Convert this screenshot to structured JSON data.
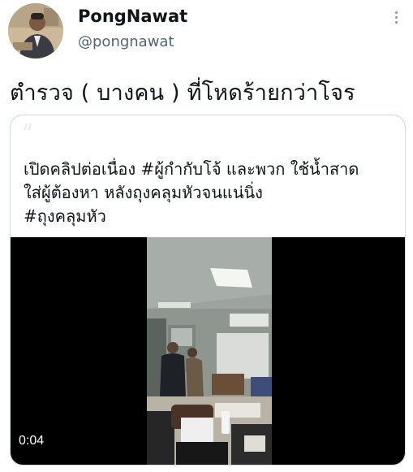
{
  "tweet": {
    "display_name": "PongNawat",
    "handle": "@pongnawat",
    "text": "ตำรวจ ( บางคน ) ที่โหดร้ายกว่าโจร"
  },
  "quoted_card": {
    "lines": [
      "เปิดคลิปต่อเนื่อง #ผู้กำกับโจ้ และพวก ใช้น้ำสาด",
      "ใส่ผู้ต้องหา หลังถุงคลุมหัวจนแน่นิ่ง",
      "#ถุงคลุมหัว"
    ]
  },
  "video": {
    "timestamp": "0:04"
  },
  "icons": {
    "more": "more-options-icon",
    "avatar": "profile-photo"
  }
}
